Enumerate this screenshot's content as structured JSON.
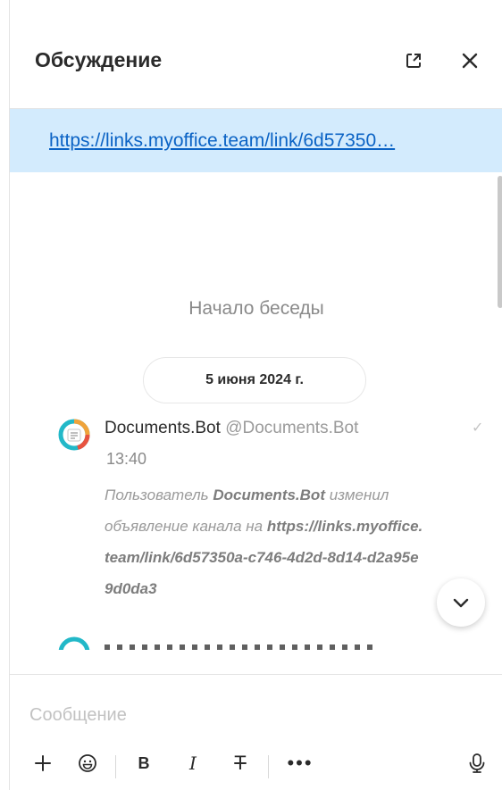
{
  "header": {
    "title": "Обсуждение"
  },
  "banner": {
    "link_text": "https://links.myoffice.team/link/6d57350…"
  },
  "conversation": {
    "start_label": "Начало беседы",
    "date_label": "5 июня 2024 г."
  },
  "message": {
    "author_name": "Documents.Bot",
    "author_handle": "@Documents.Bot",
    "time": "13:40",
    "text_prefix": "Пользователь ",
    "text_user": "Documents.Bot",
    "text_middle": " изменил объявление канала на ",
    "text_url": "https://links.myoffice.team/link/6d57350a-c746-4d2d-8d14-d2a95e9d0da3",
    "status": "✓"
  },
  "composer": {
    "placeholder": "Сообщение"
  },
  "toolbar": {
    "bold_label": "B",
    "italic_label": "I",
    "strike_label": "T",
    "more_label": "•••"
  },
  "icons": {
    "popout": "external-link-icon",
    "close": "close-icon",
    "scroll_down": "chevron-down-icon",
    "add": "plus-icon",
    "emoji": "emoji-icon",
    "mic": "microphone-icon"
  }
}
